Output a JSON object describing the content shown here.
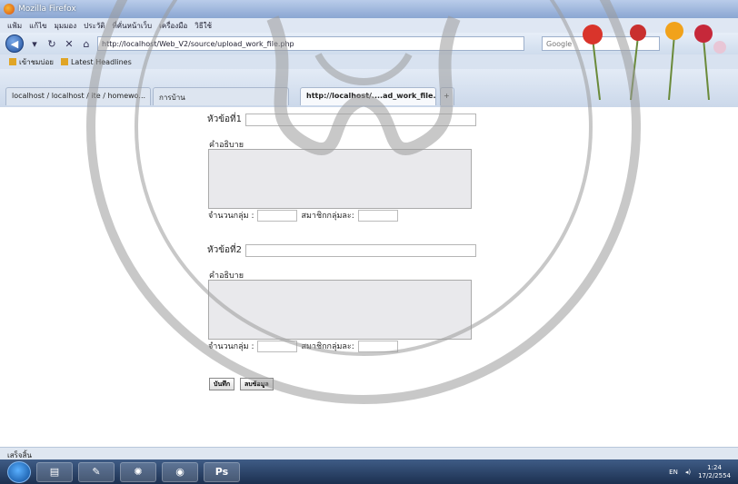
{
  "window": {
    "title": "Mozilla Firefox"
  },
  "menu": [
    "แฟ้ม",
    "แก้ไข",
    "มุมมอง",
    "ประวัติ",
    "ที่คั่นหน้าเว็บ",
    "เครื่องมือ",
    "วิธีใช้"
  ],
  "navbar": {
    "url": "http://localhost/Web_V2/source/upload_work_file.php",
    "search_placeholder": "Google"
  },
  "bookmarks": [
    "เข้าชมบ่อย",
    "Latest Headlines"
  ],
  "tabs": [
    {
      "label": "localhost / localhost / ite / homewo..."
    },
    {
      "label": "การบ้าน"
    },
    {
      "label": "http://localhost/....ad_work_file.php"
    }
  ],
  "form": {
    "topic1_label": "หัวข้อที่1",
    "desc1_label": "คำอธิบาย",
    "groups1_label": "จำนวนกลุ่ม :",
    "members1_label": "สมาชิกกลุ่มละ:",
    "topic2_label": "หัวข้อที่2",
    "desc2_label": "คำอธิบาย",
    "groups2_label": "จำนวนกลุ่ม :",
    "members2_label": "สมาชิกกลุ่มละ:",
    "save_label": "บันทึก",
    "clear_label": "ลบข้อมูล"
  },
  "status": "เสร็จสิ้น",
  "tray": {
    "lang": "EN",
    "time": "1:24",
    "date": "17/2/2554"
  }
}
